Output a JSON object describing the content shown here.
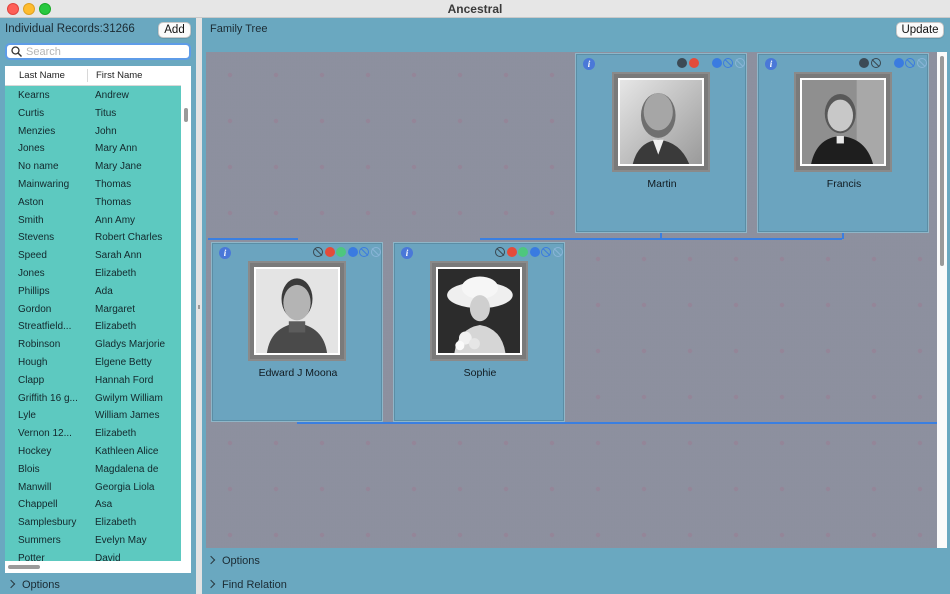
{
  "window": {
    "title": "Ancestral"
  },
  "left_panel": {
    "records_label": "Individual Records:31266",
    "add_label": "Add",
    "search_placeholder": "Search",
    "columns": {
      "last": "Last Name",
      "first": "First Name"
    },
    "rows": [
      {
        "last": "Kearns",
        "first": "Andrew"
      },
      {
        "last": "Curtis",
        "first": "Titus"
      },
      {
        "last": "Menzies",
        "first": "John"
      },
      {
        "last": "Jones",
        "first": "Mary Ann"
      },
      {
        "last": "No name",
        "first": "Mary Jane"
      },
      {
        "last": "Mainwaring",
        "first": "Thomas"
      },
      {
        "last": "Aston",
        "first": "Thomas"
      },
      {
        "last": "Smith",
        "first": "Ann Amy"
      },
      {
        "last": "Stevens",
        "first": "Robert Charles"
      },
      {
        "last": "Speed",
        "first": "Sarah Ann"
      },
      {
        "last": "Jones",
        "first": "Elizabeth"
      },
      {
        "last": "Phillips",
        "first": "Ada"
      },
      {
        "last": "Gordon",
        "first": "Margaret"
      },
      {
        "last": "Streatfield...",
        "first": "Elizabeth"
      },
      {
        "last": "Robinson",
        "first": "Gladys Marjorie"
      },
      {
        "last": "Hough",
        "first": "Elgene Betty"
      },
      {
        "last": "Clapp",
        "first": "Hannah Ford"
      },
      {
        "last": "Griffith 16 g...",
        "first": "Gwilym William"
      },
      {
        "last": "Lyle",
        "first": "William James"
      },
      {
        "last": "Vernon 12...",
        "first": "Elizabeth"
      },
      {
        "last": "Hockey",
        "first": "Kathleen Alice"
      },
      {
        "last": "Blois",
        "first": "Magdalena de"
      },
      {
        "last": "Manwill",
        "first": "Georgia Liola"
      },
      {
        "last": "Chappell",
        "first": "Asa"
      },
      {
        "last": "Samplesbury",
        "first": "Elizabeth"
      },
      {
        "last": "Summers",
        "first": "Evelyn May"
      },
      {
        "last": "Potter",
        "first": "David"
      }
    ],
    "options_label": "Options"
  },
  "right_panel": {
    "title": "Family Tree",
    "update_label": "Update",
    "options_label": "Options",
    "find_relation_label": "Find Relation",
    "people": [
      {
        "name": "Martin",
        "dots": [
          "dark",
          "red",
          "spacer",
          "blue",
          "none-blue",
          "ghost"
        ]
      },
      {
        "name": "Francis",
        "dots": [
          "dark",
          "none",
          "spacer",
          "blue",
          "none-blue",
          "ghost"
        ]
      },
      {
        "name": "Edward J Moona",
        "dots": [
          "none",
          "red",
          "green",
          "blue",
          "none-blue",
          "ghost"
        ]
      },
      {
        "name": "Sophie",
        "dots": [
          "none",
          "red",
          "green",
          "blue",
          "none-blue",
          "ghost"
        ]
      }
    ]
  },
  "colors": {
    "panel_bg": "#6aa8c0",
    "canvas_bg": "#69c8c2",
    "table_bg": "#5dc9c0",
    "connector": "#3a7fe0"
  }
}
